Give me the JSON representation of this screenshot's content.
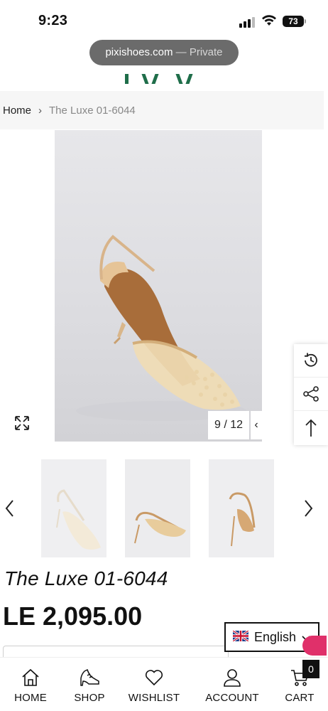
{
  "status_bar": {
    "time": "9:23",
    "battery": "73"
  },
  "browser": {
    "url_domain": "pixishoes.com",
    "url_separator": " — ",
    "url_mode": "Private"
  },
  "breadcrumb": {
    "home": "Home",
    "separator": "›",
    "current": "The Luxe 01-6044"
  },
  "gallery": {
    "counter": "9 / 12",
    "prev_glyph": "‹",
    "expand_icon": "expand-icon",
    "thumbnails": [
      {
        "name": "shoe-thumbnail-1"
      },
      {
        "name": "shoe-thumbnail-2"
      },
      {
        "name": "shoe-thumbnail-3"
      }
    ]
  },
  "side_tools": [
    "history-icon",
    "share-icon",
    "back-to-top-icon"
  ],
  "product": {
    "title": "The Luxe 01-6044",
    "price": "LE 2,095.00"
  },
  "language": {
    "label": "English",
    "flag": "uk-flag-icon"
  },
  "bottom_nav": {
    "items": [
      {
        "label": "HOME",
        "icon": "home-icon"
      },
      {
        "label": "SHOP",
        "icon": "shoe-icon"
      },
      {
        "label": "WISHLIST",
        "icon": "heart-icon"
      },
      {
        "label": "ACCOUNT",
        "icon": "user-icon"
      },
      {
        "label": "CART",
        "icon": "cart-icon"
      }
    ],
    "cart_count": "0"
  },
  "colors": {
    "brand_green": "#1f6e4a",
    "accent_pink": "#e0306a",
    "breadcrumb_bg": "#f6f6f6"
  }
}
